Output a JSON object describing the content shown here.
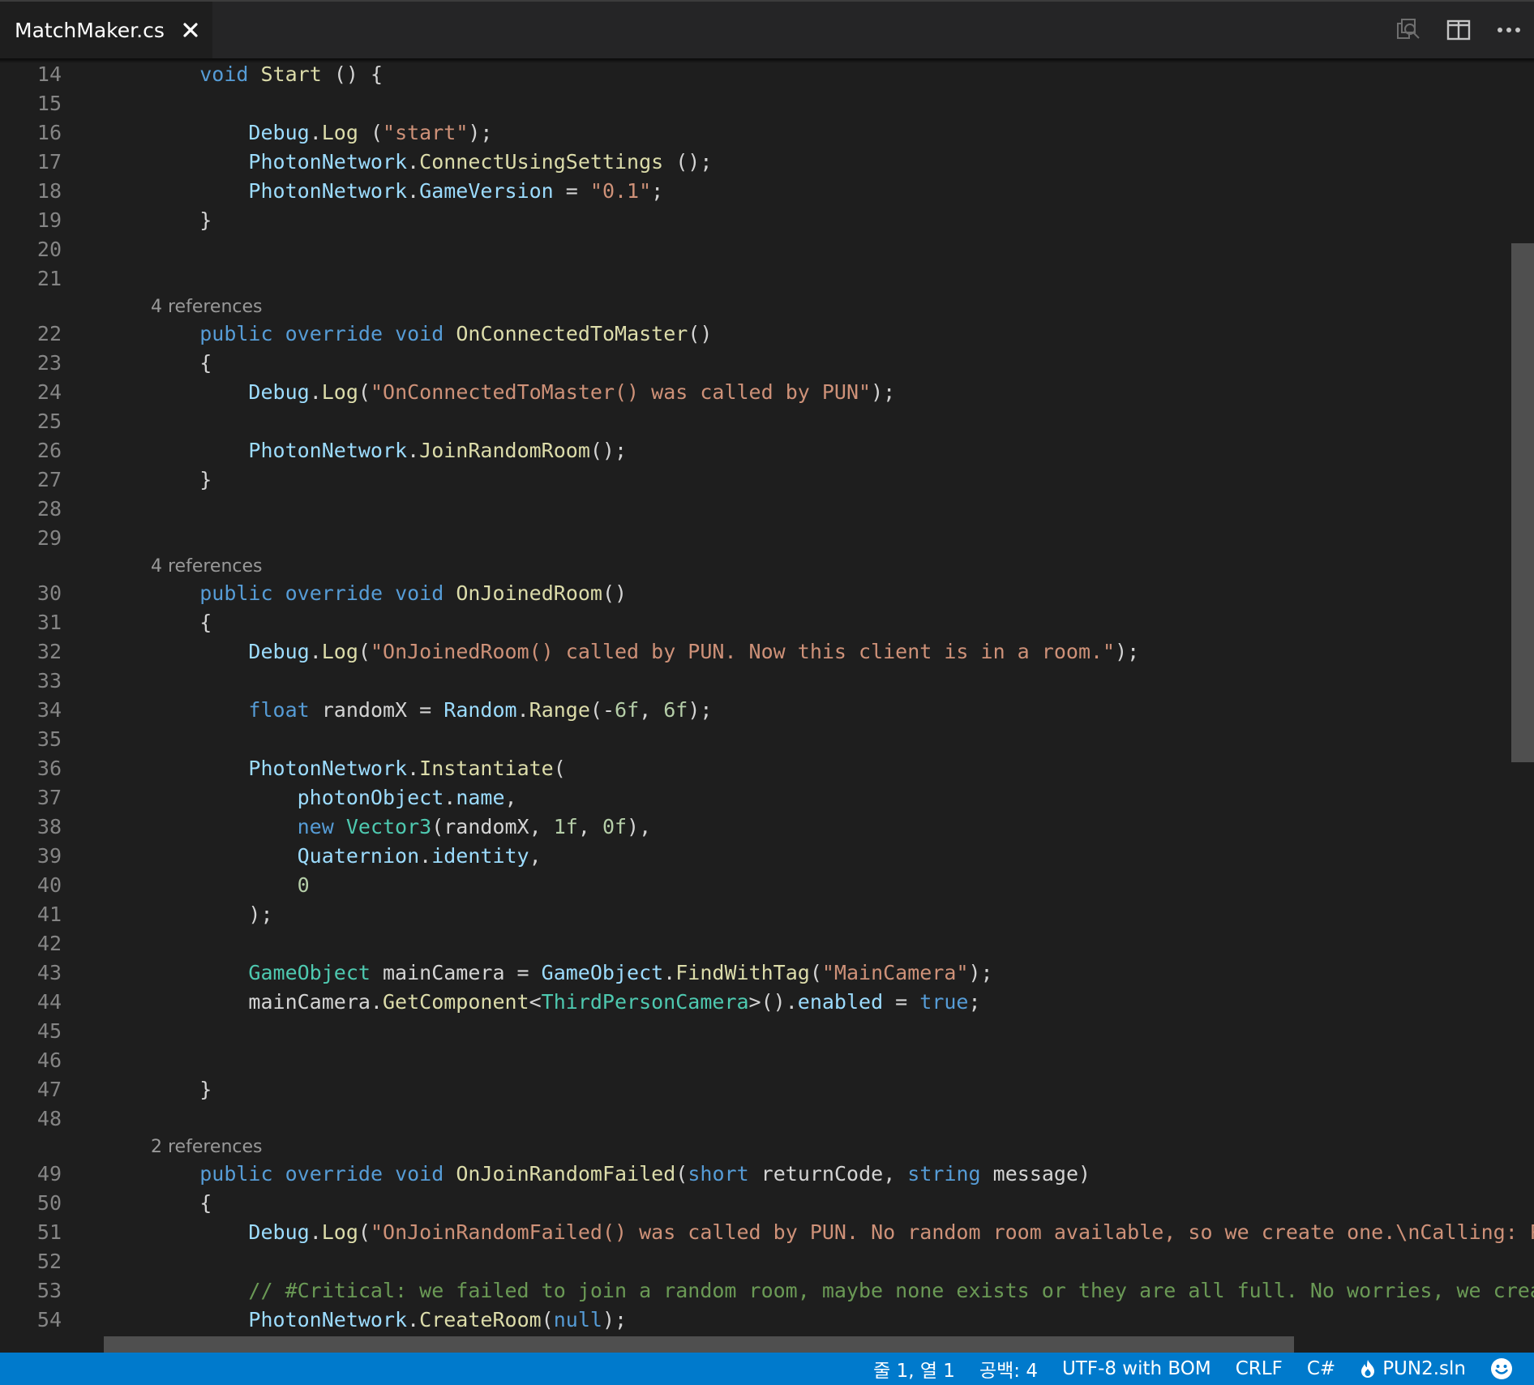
{
  "tab": {
    "title": "MatchMaker.cs"
  },
  "actions": [
    {
      "name": "find-references-icon",
      "label": "Find references"
    },
    {
      "name": "split-editor-icon",
      "label": "Split editor"
    },
    {
      "name": "more-actions-icon",
      "label": "More actions"
    }
  ],
  "code_lenses": [
    "4 references",
    "4 references",
    "2 references"
  ],
  "editor_lines": [
    {
      "n": "14",
      "tokens": [
        [
          "pl",
          "    "
        ],
        [
          "kw",
          "void"
        ],
        [
          "pl",
          " "
        ],
        [
          "fn",
          "Start"
        ],
        [
          "pl",
          " () {"
        ]
      ]
    },
    {
      "n": "15",
      "tokens": []
    },
    {
      "n": "16",
      "tokens": [
        [
          "pl",
          "        "
        ],
        [
          "var",
          "Debug"
        ],
        [
          "pl",
          "."
        ],
        [
          "fn",
          "Log"
        ],
        [
          "pl",
          " ("
        ],
        [
          "str",
          "\"start\""
        ],
        [
          "pl",
          ");"
        ]
      ]
    },
    {
      "n": "17",
      "tokens": [
        [
          "pl",
          "        "
        ],
        [
          "var",
          "PhotonNetwork"
        ],
        [
          "pl",
          "."
        ],
        [
          "fn",
          "ConnectUsingSettings"
        ],
        [
          "pl",
          " ();"
        ]
      ]
    },
    {
      "n": "18",
      "tokens": [
        [
          "pl",
          "        "
        ],
        [
          "var",
          "PhotonNetwork"
        ],
        [
          "pl",
          "."
        ],
        [
          "var",
          "GameVersion"
        ],
        [
          "pl",
          " = "
        ],
        [
          "str",
          "\"0.1\""
        ],
        [
          "pl",
          ";"
        ]
      ]
    },
    {
      "n": "19",
      "tokens": [
        [
          "pl",
          "    }"
        ]
      ]
    },
    {
      "n": "20",
      "tokens": []
    },
    {
      "n": "21",
      "tokens": []
    },
    {
      "n": "22",
      "lens": 0,
      "tokens": [
        [
          "pl",
          "    "
        ],
        [
          "kw",
          "public"
        ],
        [
          "pl",
          " "
        ],
        [
          "kw",
          "override"
        ],
        [
          "pl",
          " "
        ],
        [
          "kw",
          "void"
        ],
        [
          "pl",
          " "
        ],
        [
          "fn",
          "OnConnectedToMaster"
        ],
        [
          "pl",
          "()"
        ]
      ]
    },
    {
      "n": "23",
      "tokens": [
        [
          "pl",
          "    {"
        ]
      ]
    },
    {
      "n": "24",
      "tokens": [
        [
          "pl",
          "        "
        ],
        [
          "var",
          "Debug"
        ],
        [
          "pl",
          "."
        ],
        [
          "fn",
          "Log"
        ],
        [
          "pl",
          "("
        ],
        [
          "str",
          "\"OnConnectedToMaster() was called by PUN\""
        ],
        [
          "pl",
          ");"
        ]
      ]
    },
    {
      "n": "25",
      "tokens": []
    },
    {
      "n": "26",
      "tokens": [
        [
          "pl",
          "        "
        ],
        [
          "var",
          "PhotonNetwork"
        ],
        [
          "pl",
          "."
        ],
        [
          "fn",
          "JoinRandomRoom"
        ],
        [
          "pl",
          "();"
        ]
      ]
    },
    {
      "n": "27",
      "tokens": [
        [
          "pl",
          "    }"
        ]
      ]
    },
    {
      "n": "28",
      "tokens": []
    },
    {
      "n": "29",
      "tokens": []
    },
    {
      "n": "30",
      "lens": 1,
      "tokens": [
        [
          "pl",
          "    "
        ],
        [
          "kw",
          "public"
        ],
        [
          "pl",
          " "
        ],
        [
          "kw",
          "override"
        ],
        [
          "pl",
          " "
        ],
        [
          "kw",
          "void"
        ],
        [
          "pl",
          " "
        ],
        [
          "fn",
          "OnJoinedRoom"
        ],
        [
          "pl",
          "()"
        ]
      ]
    },
    {
      "n": "31",
      "tokens": [
        [
          "pl",
          "    {"
        ]
      ]
    },
    {
      "n": "32",
      "tokens": [
        [
          "pl",
          "        "
        ],
        [
          "var",
          "Debug"
        ],
        [
          "pl",
          "."
        ],
        [
          "fn",
          "Log"
        ],
        [
          "pl",
          "("
        ],
        [
          "str",
          "\"OnJoinedRoom() called by PUN. Now this client is in a room.\""
        ],
        [
          "pl",
          ");"
        ]
      ]
    },
    {
      "n": "33",
      "tokens": []
    },
    {
      "n": "34",
      "tokens": [
        [
          "pl",
          "        "
        ],
        [
          "kw",
          "float"
        ],
        [
          "pl",
          " randomX = "
        ],
        [
          "var",
          "Random"
        ],
        [
          "pl",
          "."
        ],
        [
          "fn",
          "Range"
        ],
        [
          "pl",
          "(-"
        ],
        [
          "num",
          "6f"
        ],
        [
          "pl",
          ", "
        ],
        [
          "num",
          "6f"
        ],
        [
          "pl",
          ");"
        ]
      ]
    },
    {
      "n": "35",
      "tokens": []
    },
    {
      "n": "36",
      "tokens": [
        [
          "pl",
          "        "
        ],
        [
          "var",
          "PhotonNetwork"
        ],
        [
          "pl",
          "."
        ],
        [
          "fn",
          "Instantiate"
        ],
        [
          "pl",
          "("
        ]
      ]
    },
    {
      "n": "37",
      "tokens": [
        [
          "pl",
          "            "
        ],
        [
          "var",
          "photonObject"
        ],
        [
          "pl",
          "."
        ],
        [
          "var",
          "name"
        ],
        [
          "pl",
          ","
        ]
      ]
    },
    {
      "n": "38",
      "tokens": [
        [
          "pl",
          "            "
        ],
        [
          "kw",
          "new"
        ],
        [
          "pl",
          " "
        ],
        [
          "type",
          "Vector3"
        ],
        [
          "pl",
          "(randomX, "
        ],
        [
          "num",
          "1f"
        ],
        [
          "pl",
          ", "
        ],
        [
          "num",
          "0f"
        ],
        [
          "pl",
          "),"
        ]
      ]
    },
    {
      "n": "39",
      "tokens": [
        [
          "pl",
          "            "
        ],
        [
          "var",
          "Quaternion"
        ],
        [
          "pl",
          "."
        ],
        [
          "var",
          "identity"
        ],
        [
          "pl",
          ","
        ]
      ]
    },
    {
      "n": "40",
      "tokens": [
        [
          "pl",
          "            "
        ],
        [
          "num",
          "0"
        ]
      ]
    },
    {
      "n": "41",
      "tokens": [
        [
          "pl",
          "        );"
        ]
      ]
    },
    {
      "n": "42",
      "tokens": []
    },
    {
      "n": "43",
      "tokens": [
        [
          "pl",
          "        "
        ],
        [
          "type",
          "GameObject"
        ],
        [
          "pl",
          " mainCamera = "
        ],
        [
          "var",
          "GameObject"
        ],
        [
          "pl",
          "."
        ],
        [
          "fn",
          "FindWithTag"
        ],
        [
          "pl",
          "("
        ],
        [
          "str",
          "\"MainCamera\""
        ],
        [
          "pl",
          ");"
        ]
      ]
    },
    {
      "n": "44",
      "tokens": [
        [
          "pl",
          "        mainCamera."
        ],
        [
          "fn",
          "GetComponent"
        ],
        [
          "pl",
          "<"
        ],
        [
          "type",
          "ThirdPersonCamera"
        ],
        [
          "pl",
          ">()."
        ],
        [
          "var",
          "enabled"
        ],
        [
          "pl",
          " = "
        ],
        [
          "kw",
          "true"
        ],
        [
          "pl",
          ";"
        ]
      ]
    },
    {
      "n": "45",
      "tokens": []
    },
    {
      "n": "46",
      "tokens": []
    },
    {
      "n": "47",
      "tokens": [
        [
          "pl",
          "    }"
        ]
      ]
    },
    {
      "n": "48",
      "tokens": []
    },
    {
      "n": "49",
      "lens": 2,
      "tokens": [
        [
          "pl",
          "    "
        ],
        [
          "kw",
          "public"
        ],
        [
          "pl",
          " "
        ],
        [
          "kw",
          "override"
        ],
        [
          "pl",
          " "
        ],
        [
          "kw",
          "void"
        ],
        [
          "pl",
          " "
        ],
        [
          "fn",
          "OnJoinRandomFailed"
        ],
        [
          "pl",
          "("
        ],
        [
          "kw",
          "short"
        ],
        [
          "pl",
          " returnCode, "
        ],
        [
          "kw",
          "string"
        ],
        [
          "pl",
          " message)"
        ]
      ]
    },
    {
      "n": "50",
      "tokens": [
        [
          "pl",
          "    {"
        ]
      ]
    },
    {
      "n": "51",
      "tokens": [
        [
          "pl",
          "        "
        ],
        [
          "var",
          "Debug"
        ],
        [
          "pl",
          "."
        ],
        [
          "fn",
          "Log"
        ],
        [
          "pl",
          "("
        ],
        [
          "str",
          "\"OnJoinRandomFailed() was called by PUN. No random room available, so we create one.\\nCalling: PhotonNet"
        ]
      ]
    },
    {
      "n": "52",
      "tokens": []
    },
    {
      "n": "53",
      "tokens": [
        [
          "pl",
          "        "
        ],
        [
          "cmt",
          "// #Critical: we failed to join a random room, maybe none exists or they are all full. No worries, we create a new"
        ]
      ]
    },
    {
      "n": "54",
      "tokens": [
        [
          "pl",
          "        "
        ],
        [
          "var",
          "PhotonNetwork"
        ],
        [
          "pl",
          "."
        ],
        [
          "fn",
          "CreateRoom"
        ],
        [
          "pl",
          "("
        ],
        [
          "kw",
          "null"
        ],
        [
          "pl",
          ");"
        ]
      ]
    }
  ],
  "status": {
    "cursor": "줄 1, 열 1",
    "indent": "공백: 4",
    "encoding": "UTF-8 with BOM",
    "eol": "CRLF",
    "language": "C#",
    "solution": "PUN2.sln"
  }
}
